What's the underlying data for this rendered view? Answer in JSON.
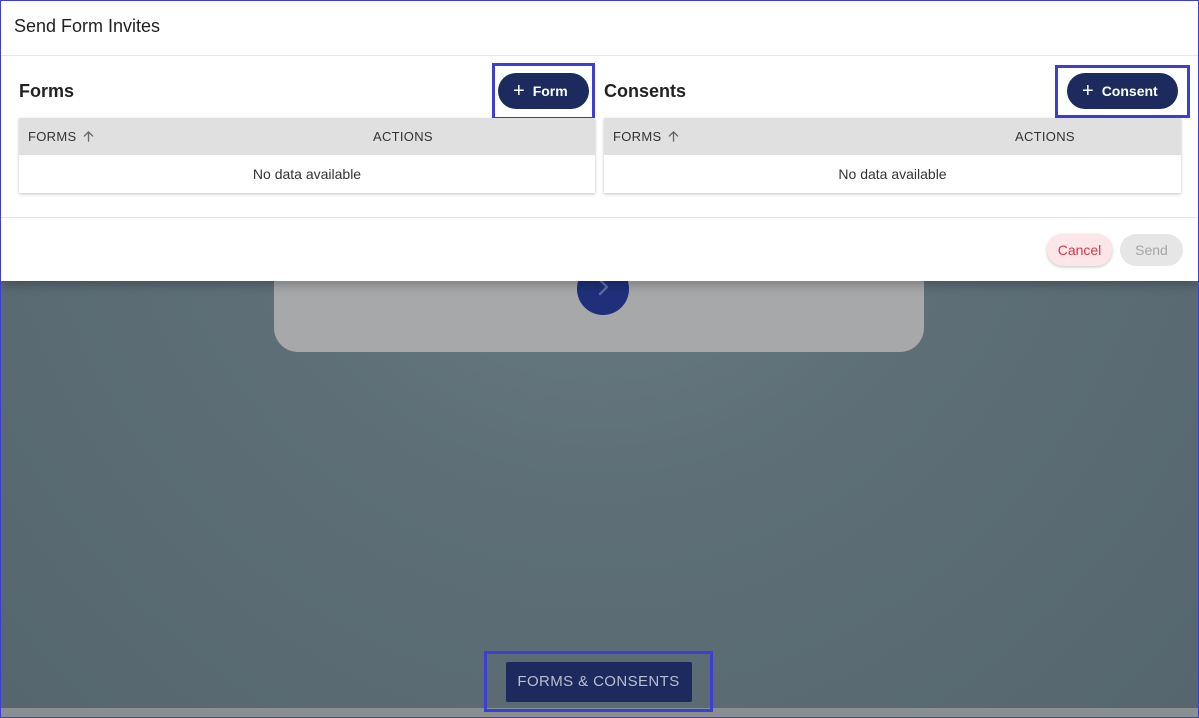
{
  "modal": {
    "title": "Send Form Invites",
    "forms_panel": {
      "title": "Forms",
      "add_button_label": "Form",
      "columns": [
        "FORMS",
        "ACTIONS"
      ],
      "empty_text": "No data available"
    },
    "consents_panel": {
      "title": "Consents",
      "add_button_label": "Consent",
      "columns": [
        "FORMS",
        "ACTIONS"
      ],
      "empty_text": "No data available"
    },
    "footer": {
      "cancel_label": "Cancel",
      "send_label": "Send"
    }
  },
  "background": {
    "bottom_button_label": "FORMS & CONSENTS"
  },
  "icons": {
    "add": "plus-icon",
    "sort": "arrow-up-icon",
    "next": "chevron-right-icon"
  },
  "colors": {
    "primary": "#1c2a5e",
    "cancel_text": "#d23a45",
    "cancel_bg": "#fde6e7",
    "disabled_bg": "#e6e6e6",
    "highlight_border": "#3c3fd1"
  }
}
